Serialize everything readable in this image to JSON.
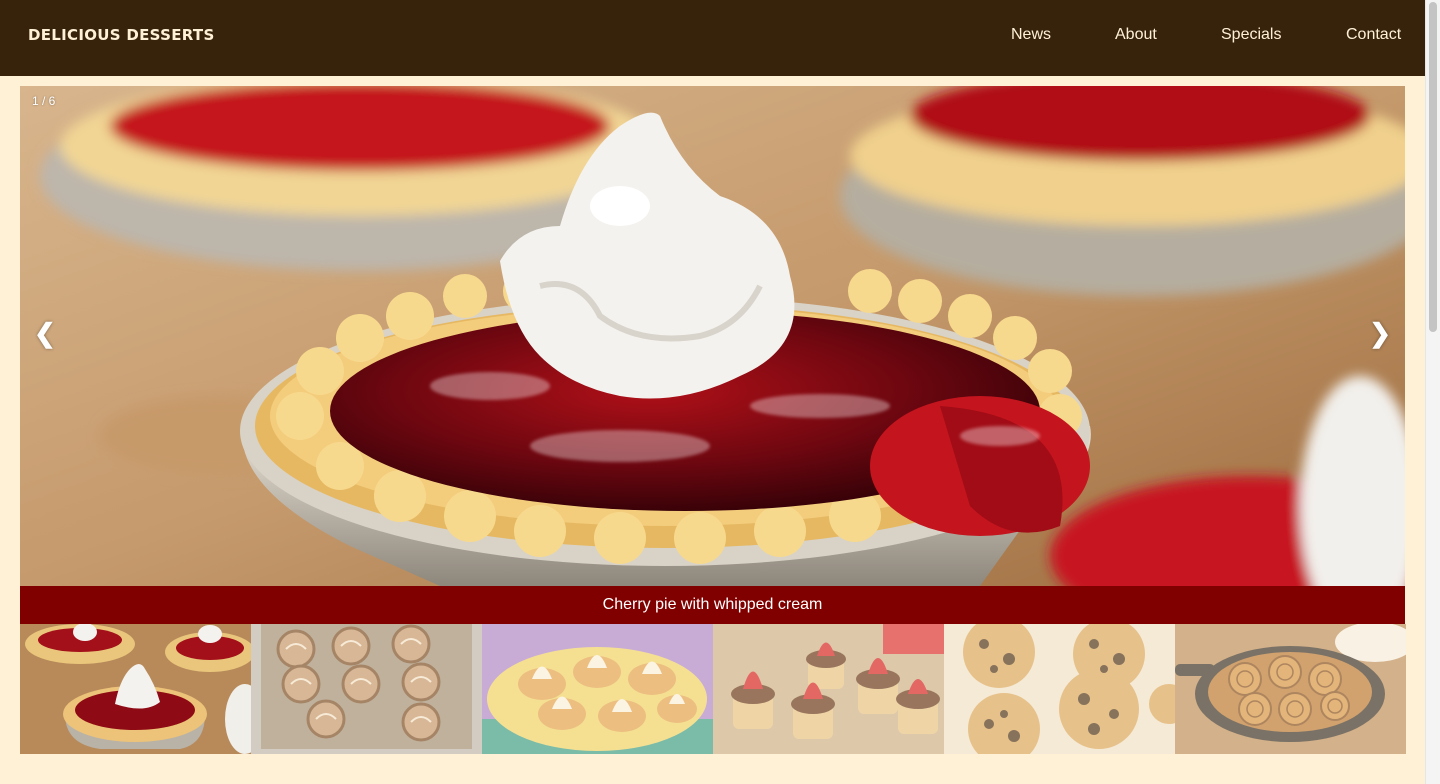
{
  "header": {
    "brand": "DELICIOUS DESSERTS",
    "nav": [
      "News",
      "About",
      "Specials",
      "Contact"
    ]
  },
  "slideshow": {
    "counter": "1 / 6",
    "prev_arrow": "❮",
    "next_arrow": "❯",
    "caption": "Cherry pie with whipped cream",
    "main_image": "cherry-pie-with-whipped-cream",
    "thumbnails": [
      {
        "image": "cherry-pies",
        "active": true
      },
      {
        "image": "swirl-pastries",
        "active": false
      },
      {
        "image": "cream-tarts",
        "active": false
      },
      {
        "image": "strawberry-chocolate-cupcakes",
        "active": false
      },
      {
        "image": "chocolate-chip-cookies",
        "active": false
      },
      {
        "image": "cinnamon-rolls-in-skillet",
        "active": false
      }
    ]
  },
  "colors": {
    "navbar": "#37230c",
    "background": "#fff1d6",
    "caption_bar": "#800000",
    "nav_text": "#fff1d6"
  }
}
